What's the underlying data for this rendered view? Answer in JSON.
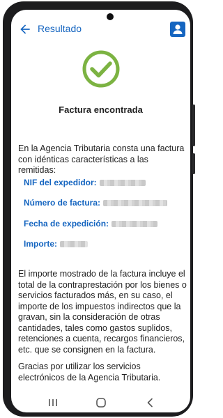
{
  "appbar": {
    "title": "Resultado",
    "back_icon": "arrow-back-icon",
    "account_icon": "account-box-icon"
  },
  "status": {
    "icon": "check-circle-icon",
    "heading": "Factura encontrada"
  },
  "intro_text": "En la Agencia Tributaria consta una factura con idénticas características a las remitidas:",
  "fields": [
    {
      "label": "NIF del expedidor:"
    },
    {
      "label": "Número de factura:"
    },
    {
      "label": "Fecha de expedición:"
    },
    {
      "label": "Importe:"
    }
  ],
  "explanation": "El importe mostrado de la factura incluye el total de la contraprestación por los bienes o servicios facturados más, en su caso, el importe de los impuestos indirectos que la gravan, sin la consideración de otras cantidades, tales como gastos suplidos, retenciones a cuenta, recargos financieros, etc. que se consignen en la factura.",
  "thanks_text": "Gracias por utilizar los servicios electrónicos de la Agencia Tributaria.",
  "navbar": [
    "recent-apps-icon",
    "home-icon",
    "back-icon"
  ],
  "colors": {
    "accent": "#1565c0",
    "check": "#7cb342"
  }
}
